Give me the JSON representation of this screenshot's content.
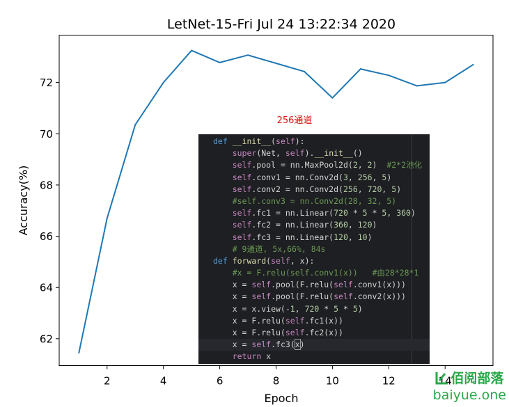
{
  "chart_data": {
    "type": "line",
    "title": "LetNet-15-Fri Jul 24 13:22:34 2020",
    "xlabel": "Epoch",
    "ylabel": "Accuracy(%)",
    "x": [
      1,
      2,
      3,
      4,
      5,
      6,
      7,
      8,
      9,
      10,
      11,
      12,
      13,
      14,
      15
    ],
    "series": [
      {
        "values": [
          61.45,
          66.7,
          70.35,
          72.0,
          73.25,
          72.78,
          73.07,
          72.75,
          72.43,
          71.4,
          72.53,
          72.28,
          71.87,
          72.0,
          72.7
        ]
      }
    ],
    "xlim": [
      0.3,
      15.7
    ],
    "ylim": [
      60.95,
      73.85
    ],
    "xticks": [
      2,
      4,
      6,
      8,
      10,
      12,
      14
    ],
    "xtick_labels": [
      "2",
      "4",
      "6",
      "8",
      "10",
      "12",
      "14"
    ],
    "yticks": [
      62,
      64,
      66,
      68,
      70,
      72
    ],
    "ytick_labels": [
      "62",
      "64",
      "66",
      "68",
      "70",
      "72"
    ],
    "grid": false,
    "line_color": "#1f77b4"
  },
  "annotation": {
    "text": "256通道",
    "color": "#e01010"
  },
  "code": {
    "lines": [
      [
        [
          "kw",
          "def "
        ],
        [
          "fn",
          "__init__"
        ],
        [
          "id",
          "("
        ],
        [
          "self",
          "self"
        ],
        [
          "id",
          "):"
        ]
      ],
      [
        [
          "id",
          "    "
        ],
        [
          "self",
          "super"
        ],
        [
          "id",
          "(Net, "
        ],
        [
          "self",
          "self"
        ],
        [
          "id",
          ")."
        ],
        [
          "fn",
          "__init__"
        ],
        [
          "id",
          "()"
        ]
      ],
      [
        [
          "id",
          "    "
        ],
        [
          "self",
          "self"
        ],
        [
          "id",
          ".pool = nn.MaxPool2d("
        ],
        [
          "num",
          "2"
        ],
        [
          "id",
          ", "
        ],
        [
          "num",
          "2"
        ],
        [
          "id",
          ")  "
        ],
        [
          "cm",
          "#2*2池化"
        ]
      ],
      [
        [
          "id",
          "    "
        ],
        [
          "self",
          "self"
        ],
        [
          "id",
          ".conv1 = nn.Conv2d("
        ],
        [
          "num",
          "3"
        ],
        [
          "id",
          ", "
        ],
        [
          "num",
          "256"
        ],
        [
          "id",
          ", "
        ],
        [
          "num",
          "5"
        ],
        [
          "id",
          ")"
        ]
      ],
      [
        [
          "id",
          "    "
        ],
        [
          "self",
          "self"
        ],
        [
          "id",
          ".conv2 = nn.Conv2d("
        ],
        [
          "num",
          "256"
        ],
        [
          "id",
          ", "
        ],
        [
          "num",
          "720"
        ],
        [
          "id",
          ", "
        ],
        [
          "num",
          "5"
        ],
        [
          "id",
          ")"
        ]
      ],
      [
        [
          "id",
          "    "
        ],
        [
          "cm",
          "#self.conv3 = nn.Conv2d(28, 32, 5)"
        ]
      ],
      [
        [
          "id",
          "    "
        ],
        [
          "self",
          "self"
        ],
        [
          "id",
          ".fc1 = nn.Linear("
        ],
        [
          "num",
          "720"
        ],
        [
          "id",
          " * "
        ],
        [
          "num",
          "5"
        ],
        [
          "id",
          " * "
        ],
        [
          "num",
          "5"
        ],
        [
          "id",
          ", "
        ],
        [
          "num",
          "360"
        ],
        [
          "id",
          ")"
        ]
      ],
      [
        [
          "id",
          "    "
        ],
        [
          "self",
          "self"
        ],
        [
          "id",
          ".fc2 = nn.Linear("
        ],
        [
          "num",
          "360"
        ],
        [
          "id",
          ", "
        ],
        [
          "num",
          "120"
        ],
        [
          "id",
          ")"
        ]
      ],
      [
        [
          "id",
          "    "
        ],
        [
          "self",
          "self"
        ],
        [
          "id",
          ".fc3 = nn.Linear("
        ],
        [
          "num",
          "120"
        ],
        [
          "id",
          ", "
        ],
        [
          "num",
          "10"
        ],
        [
          "id",
          ")"
        ]
      ],
      [
        [
          "id",
          "    "
        ],
        [
          "cm",
          "# 9通道, 5x,66%, 84s"
        ]
      ],
      [
        [
          "kw",
          "def "
        ],
        [
          "fn",
          "forward"
        ],
        [
          "id",
          "("
        ],
        [
          "self",
          "self"
        ],
        [
          "id",
          ", x):"
        ]
      ],
      [
        [
          "id",
          "    "
        ],
        [
          "cm",
          "#x = F.relu(self.conv1(x))   #由28*28*1"
        ]
      ],
      [
        [
          "id",
          "    x = "
        ],
        [
          "self",
          "self"
        ],
        [
          "id",
          ".pool(F.relu("
        ],
        [
          "self",
          "self"
        ],
        [
          "id",
          ".conv1(x)))"
        ]
      ],
      [
        [
          "id",
          "    x = "
        ],
        [
          "self",
          "self"
        ],
        [
          "id",
          ".pool(F.relu("
        ],
        [
          "self",
          "self"
        ],
        [
          "id",
          ".conv2(x)))"
        ]
      ],
      [
        [
          "id",
          "    x = x.view(-"
        ],
        [
          "num",
          "1"
        ],
        [
          "id",
          ", "
        ],
        [
          "num",
          "720"
        ],
        [
          "id",
          " * "
        ],
        [
          "num",
          "5"
        ],
        [
          "id",
          " * "
        ],
        [
          "num",
          "5"
        ],
        [
          "id",
          ")"
        ]
      ],
      [
        [
          "id",
          "    x = F.relu("
        ],
        [
          "self",
          "self"
        ],
        [
          "id",
          ".fc1(x))"
        ]
      ],
      [
        [
          "id",
          "    x = F.relu("
        ],
        [
          "self",
          "self"
        ],
        [
          "id",
          ".fc2(x))"
        ]
      ],
      [
        [
          "id",
          "    x = "
        ],
        [
          "self",
          "self"
        ],
        [
          "id",
          ".fc3("
        ],
        [
          "cursor",
          "x"
        ],
        [
          "id",
          ")"
        ]
      ],
      [
        [
          "id",
          "    "
        ],
        [
          "ret",
          "return"
        ],
        [
          "id",
          " x"
        ]
      ]
    ]
  },
  "watermark": {
    "brand": "佰阅部落",
    "domain": "baiyue.one",
    "color": "#2aa84a"
  }
}
